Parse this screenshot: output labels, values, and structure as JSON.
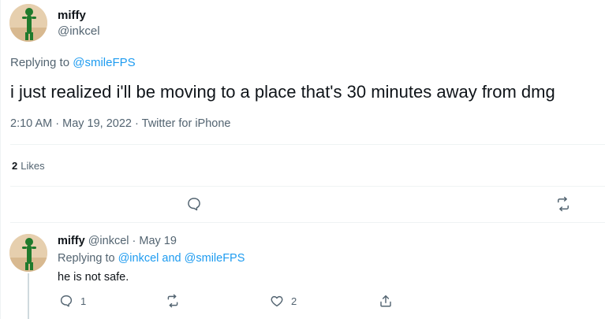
{
  "main_tweet": {
    "name": "miffy",
    "handle": "@inkcel",
    "replying_prefix": "Replying to",
    "replying_to": "@smileFPS",
    "text": "i just realized i'll be moving to a place that's 30 minutes away from dmg",
    "time": "2:10 AM",
    "separator": "·",
    "date": "May 19, 2022",
    "source": "Twitter for iPhone",
    "likes_count": "2",
    "likes_label": "Likes"
  },
  "main_actions": {
    "reply_icon": "reply-icon",
    "retweet_icon": "retweet-icon"
  },
  "reply_tweet": {
    "name": "miffy",
    "handle": "@inkcel",
    "separator": "·",
    "date": "May 19",
    "replying_prefix": "Replying to",
    "replying_to_1": "@inkcel",
    "replying_and": "and",
    "replying_to_2": "@smileFPS",
    "text": "he is not safe.",
    "reply_count": "1",
    "retweet_count": "",
    "like_count": "2"
  },
  "colors": {
    "link": "#1d9bf0",
    "secondary_text": "#536471",
    "primary_text": "#0f1419",
    "divider": "#eff3f4"
  }
}
